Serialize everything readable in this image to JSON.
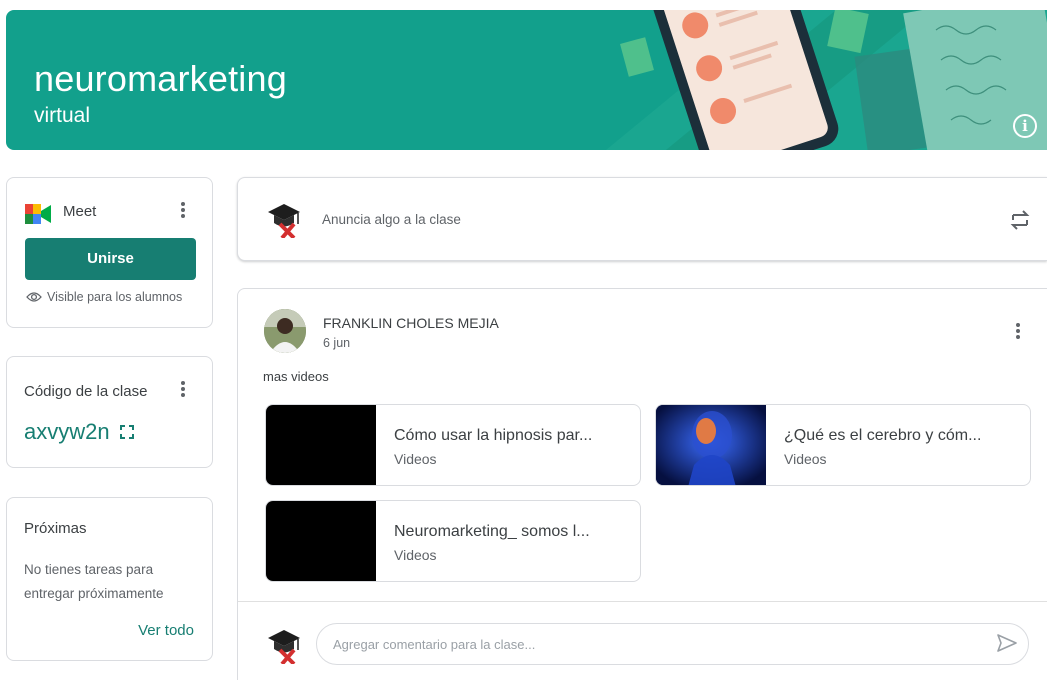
{
  "banner": {
    "title": "neuromarketing",
    "subtitle": "virtual",
    "color": "#12a08c"
  },
  "meet": {
    "label": "Meet",
    "join_label": "Unirse",
    "visibility": "Visible para los alumnos"
  },
  "class_code": {
    "label": "Código de la clase",
    "value": "axvyw2n"
  },
  "upcoming": {
    "title": "Próximas",
    "empty_text": "No tienes tareas para entregar próximamente",
    "link": "Ver todo"
  },
  "announce": {
    "placeholder": "Anuncia algo a la clase"
  },
  "post": {
    "author": "FRANKLIN CHOLES MEJIA",
    "date": "6 jun",
    "body": "mas videos",
    "attachments": [
      {
        "title": "Cómo usar la hipnosis par...",
        "type": "Videos"
      },
      {
        "title": "¿Qué es el cerebro y cóm...",
        "type": "Videos"
      },
      {
        "title": "Neuromarketing_ somos l...",
        "type": "Videos"
      }
    ],
    "comment_placeholder": "Agregar comentario para la clase..."
  },
  "colors": {
    "accent": "#177e72",
    "banner": "#12a08c"
  },
  "icons": [
    "info-icon",
    "meet-icon",
    "more-vert-icon",
    "eye-icon",
    "fullscreen-icon",
    "graduation-avatar-icon",
    "repost-icon",
    "send-icon"
  ]
}
